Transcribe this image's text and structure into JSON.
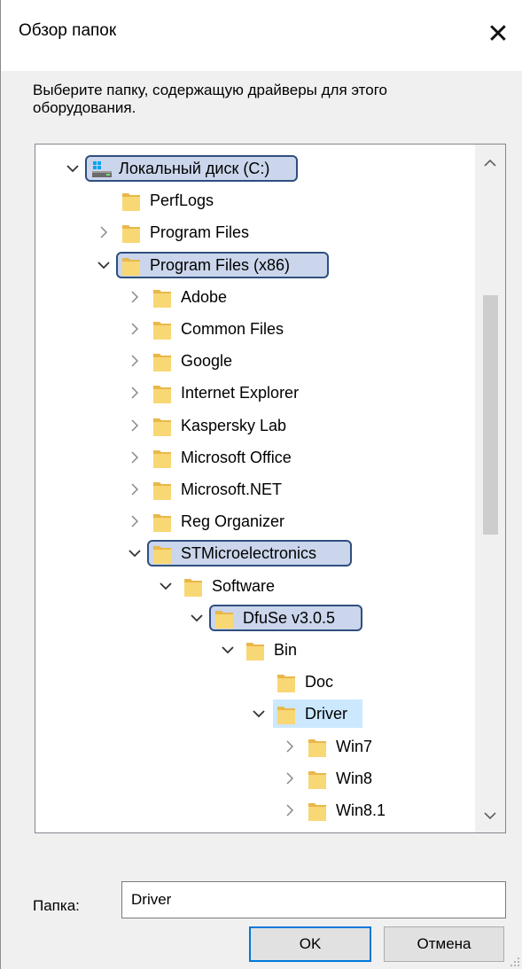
{
  "window": {
    "title": "Обзор папок",
    "close_icon": "close-icon"
  },
  "instructions": "Выберите папку, содержащую драйверы для этого оборудования.",
  "tree": {
    "items": [
      {
        "label": "Локальный диск (C:)",
        "level": 0,
        "expander": "expanded",
        "icon": "drive-icon",
        "highlighted": true
      },
      {
        "label": "PerfLogs",
        "level": 1,
        "expander": "none",
        "icon": "folder-icon"
      },
      {
        "label": "Program Files",
        "level": 1,
        "expander": "collapsed",
        "icon": "folder-icon"
      },
      {
        "label": "Program Files (x86)",
        "level": 1,
        "expander": "expanded",
        "icon": "folder-icon",
        "highlighted": true
      },
      {
        "label": "Adobe",
        "level": 2,
        "expander": "collapsed",
        "icon": "folder-icon"
      },
      {
        "label": "Common Files",
        "level": 2,
        "expander": "collapsed",
        "icon": "folder-icon"
      },
      {
        "label": "Google",
        "level": 2,
        "expander": "collapsed",
        "icon": "folder-icon"
      },
      {
        "label": "Internet Explorer",
        "level": 2,
        "expander": "collapsed",
        "icon": "folder-icon"
      },
      {
        "label": "Kaspersky Lab",
        "level": 2,
        "expander": "collapsed",
        "icon": "folder-icon"
      },
      {
        "label": "Microsoft Office",
        "level": 2,
        "expander": "collapsed",
        "icon": "folder-icon"
      },
      {
        "label": "Microsoft.NET",
        "level": 2,
        "expander": "collapsed",
        "icon": "folder-icon"
      },
      {
        "label": "Reg Organizer",
        "level": 2,
        "expander": "collapsed",
        "icon": "folder-icon"
      },
      {
        "label": "STMicroelectronics",
        "level": 2,
        "expander": "expanded",
        "icon": "folder-icon",
        "highlighted": true
      },
      {
        "label": "Software",
        "level": 3,
        "expander": "expanded",
        "icon": "folder-icon"
      },
      {
        "label": "DfuSe v3.0.5",
        "level": 4,
        "expander": "expanded",
        "icon": "folder-icon",
        "highlighted": true
      },
      {
        "label": "Bin",
        "level": 5,
        "expander": "expanded",
        "icon": "folder-icon"
      },
      {
        "label": "Doc",
        "level": 6,
        "expander": "none",
        "icon": "folder-icon"
      },
      {
        "label": "Driver",
        "level": 6,
        "expander": "expanded",
        "icon": "folder-icon",
        "selected": true
      },
      {
        "label": "Win7",
        "level": 7,
        "expander": "collapsed",
        "icon": "folder-icon"
      },
      {
        "label": "Win8",
        "level": 7,
        "expander": "collapsed",
        "icon": "folder-icon"
      },
      {
        "label": "Win8.1",
        "level": 7,
        "expander": "collapsed",
        "icon": "folder-icon"
      }
    ]
  },
  "folder_field": {
    "label": "Папка:",
    "value": "Driver"
  },
  "buttons": {
    "ok": "OK",
    "cancel": "Отмена"
  },
  "colors": {
    "annotation_fill": "#a0b4dc",
    "annotation_border": "#2f4f7f",
    "selection": "#cce8ff",
    "folder": "#f8d775"
  }
}
